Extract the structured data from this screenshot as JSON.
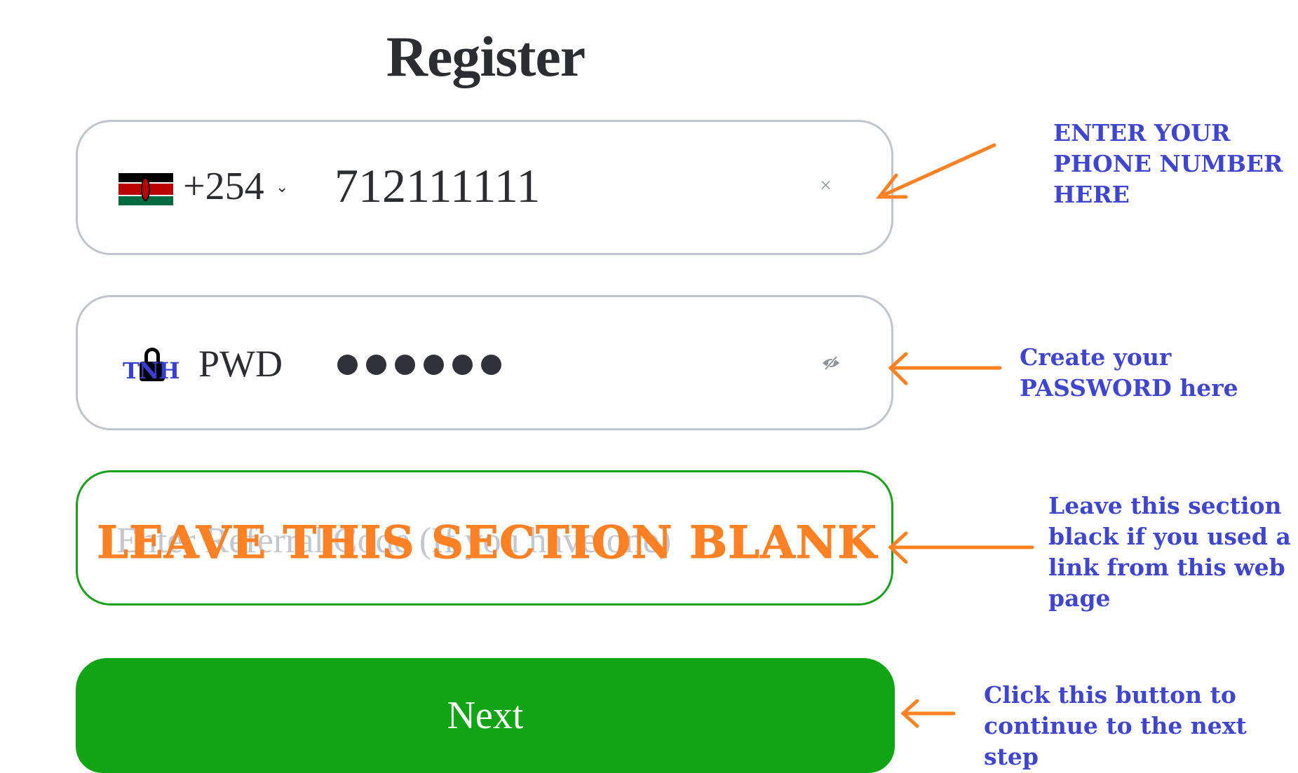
{
  "page": {
    "title": "Register"
  },
  "phone_field": {
    "country_flag": "kenya-flag",
    "country_code": "+254",
    "dropdown_icon": "chevron-down-icon",
    "value": "712111111",
    "clear_icon": "×"
  },
  "password_field": {
    "lock_icon": "lock-icon",
    "watermark": "TNH",
    "label": "PWD",
    "masked_length": 6,
    "visibility_icon": "eye-off-icon"
  },
  "referral_field": {
    "placeholder": "Enter Referral Code (If you have one)",
    "value": "",
    "overlay_text": "LEAVE THIS SECTION BLANK"
  },
  "next_button": {
    "label": "Next"
  },
  "annotations": [
    {
      "text": "ENTER YOUR\nPHONE NUMBER\nHERE"
    },
    {
      "text": "Create your\nPASSWORD here"
    },
    {
      "text": "Leave this section\nblack if you used a\nlink from this web\npage"
    },
    {
      "text": "Click this button to\ncontinue to the next step"
    }
  ],
  "colors": {
    "accent_green": "#11a515",
    "annotation_blue": "#4045cf",
    "annotation_orange": "#ff8124",
    "field_border": "#c0c4cc"
  }
}
